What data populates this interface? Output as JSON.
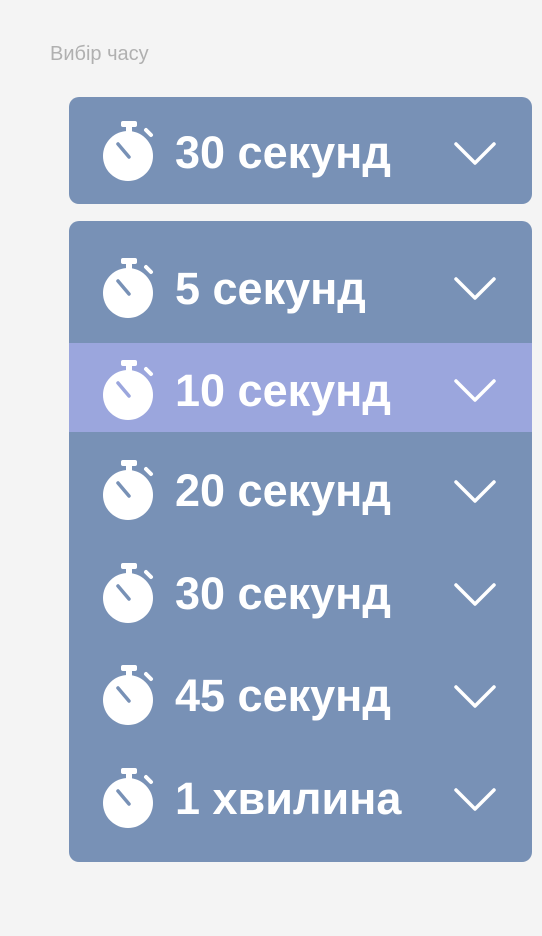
{
  "caption": "Вибір часу",
  "select": {
    "value": "30 секунд",
    "icon": "stopwatch-icon",
    "chevron": "chevron-down-icon"
  },
  "options": [
    {
      "label": "5 секунд",
      "selected": false
    },
    {
      "label": "10 секунд",
      "selected": true
    },
    {
      "label": "20 секунд",
      "selected": false
    },
    {
      "label": "30 секунд",
      "selected": false
    },
    {
      "label": "45 секунд",
      "selected": false
    },
    {
      "label": "1 хвилина",
      "selected": false
    }
  ],
  "colors": {
    "background": "#f4f4f4",
    "panel": "#7891b6",
    "selected_option": "#9ba6dd",
    "text": "#ffffff",
    "caption": "#b0b0b0"
  }
}
